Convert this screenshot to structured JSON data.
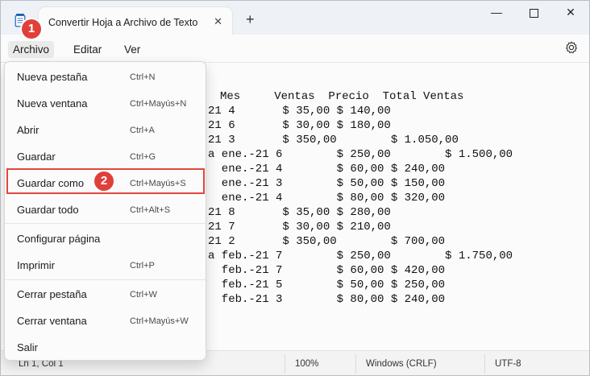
{
  "window": {
    "tab_title": "Convertir Hoja a Archivo de Texto",
    "tab_close": "✕",
    "new_tab": "+",
    "min": "—",
    "close": "✕"
  },
  "menubar": {
    "archivo": "Archivo",
    "editar": "Editar",
    "ver": "Ver"
  },
  "dropdown": {
    "items": [
      {
        "label": "Nueva pestaña",
        "shortcut": "Ctrl+N"
      },
      {
        "label": "Nueva ventana",
        "shortcut": "Ctrl+Mayús+N"
      },
      {
        "label": "Abrir",
        "shortcut": "Ctrl+A"
      },
      {
        "label": "Guardar",
        "shortcut": "Ctrl+G"
      },
      {
        "label": "Guardar como",
        "shortcut": "Ctrl+Mayús+S"
      },
      {
        "label": "Guardar todo",
        "shortcut": "Ctrl+Alt+S"
      },
      {
        "label": "Configurar página",
        "shortcut": ""
      },
      {
        "label": "Imprimir",
        "shortcut": "Ctrl+P"
      },
      {
        "label": "Cerrar pestaña",
        "shortcut": "Ctrl+W"
      },
      {
        "label": "Cerrar ventana",
        "shortcut": "Ctrl+Mayús+W"
      },
      {
        "label": "Salir",
        "shortcut": ""
      }
    ]
  },
  "editor": {
    "lines": [
      "Mes     Ventas  Precio  Total Ventas",
      "21 4       $ 35,00 $ 140,00",
      "21 6       $ 30,00 $ 180,00",
      "21 3       $ 350,00        $ 1.050,00",
      "a ene.-21 6        $ 250,00        $ 1.500,00",
      "  ene.-21 4        $ 60,00 $ 240,00",
      "  ene.-21 3        $ 50,00 $ 150,00",
      "  ene.-21 4        $ 80,00 $ 320,00",
      "21 8       $ 35,00 $ 280,00",
      "21 7       $ 30,00 $ 210,00",
      "21 2       $ 350,00        $ 700,00",
      "a feb.-21 7        $ 250,00        $ 1.750,00",
      "  feb.-21 7        $ 60,00 $ 420,00",
      "  feb.-21 5        $ 50,00 $ 250,00",
      "  feb.-21 3        $ 80,00 $ 240,00"
    ]
  },
  "statusbar": {
    "position": "Ln 1, Col 1",
    "zoom": "100%",
    "line_ending": "Windows (CRLF)",
    "encoding": "UTF-8"
  },
  "annotations": {
    "step1": "1",
    "step2": "2"
  },
  "colors": {
    "accent_red": "#e0403a",
    "background": "#fbfbfb"
  }
}
